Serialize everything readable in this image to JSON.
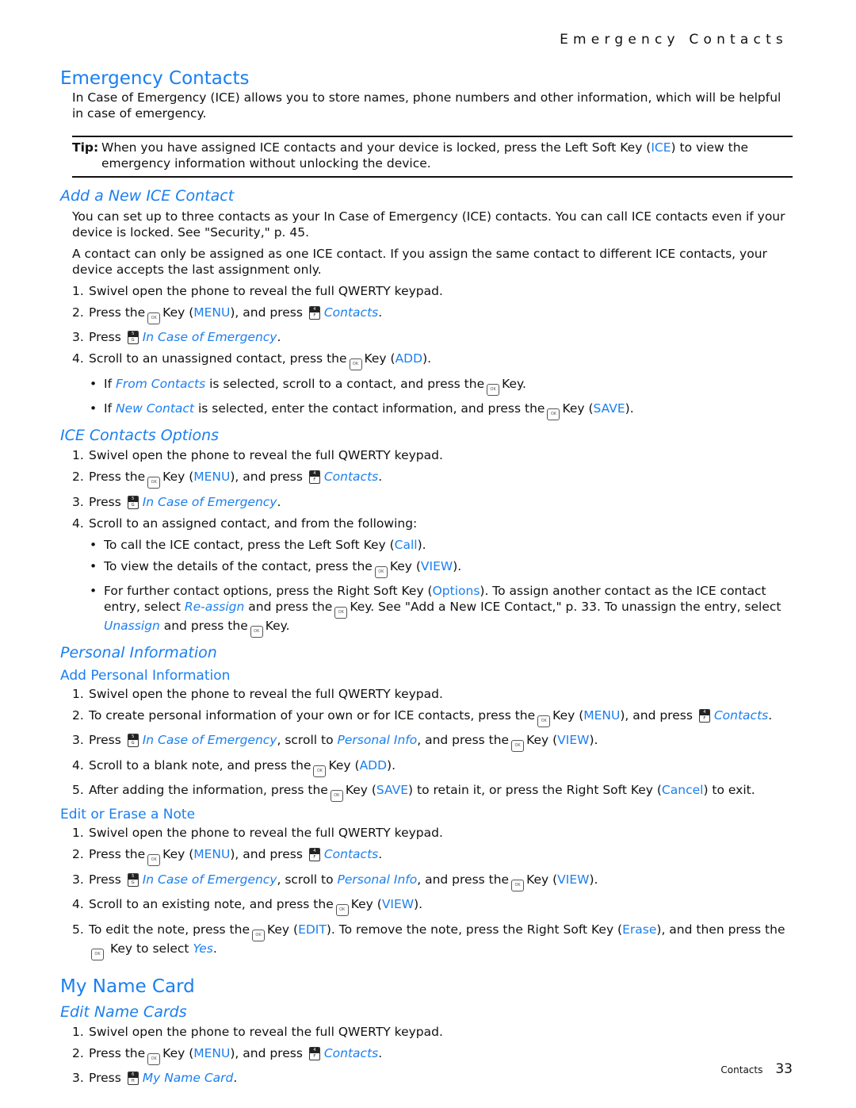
{
  "running_head": "Emergency Contacts",
  "accent_color": "#1a7ff0",
  "icons": {
    "ok_key": "ok-key-icon",
    "key_4f": {
      "top": "4",
      "bottom": "F"
    },
    "key_5g": {
      "top": "5",
      "bottom": "G"
    },
    "key_6h": {
      "top": "6",
      "bottom": "H"
    }
  },
  "sections": {
    "emergency": {
      "title": "Emergency Contacts",
      "intro": "In Case of Emergency (ICE) allows you to store names, phone numbers and other information, which will be helpful in case of emergency.",
      "tip_label": "Tip:",
      "tip_pre": "When you have assigned ICE contacts and your device is locked, press the Left Soft Key (",
      "tip_ice": "ICE",
      "tip_post": ") to view the emergency information without unlocking the device."
    },
    "add_ice": {
      "title": "Add a New ICE Contact",
      "para1": "You can set up to three contacts as your In Case of Emergency (ICE) contacts. You can call ICE contacts even if your device is locked. See \"Security,\" p. 45.",
      "para2": "A contact can only be assigned as one ICE contact. If you assign the same contact to different ICE contacts, your device accepts the last assignment only."
    },
    "ice_options": {
      "title": "ICE Contacts Options"
    },
    "personal": {
      "title": "Personal Information",
      "add_title": "Add Personal Information",
      "edit_title": "Edit or Erase a Note"
    },
    "name_card": {
      "title": "My Name Card",
      "edit_title": "Edit Name Cards"
    }
  },
  "text": {
    "n1": "1.",
    "n2": "2.",
    "n3": "3.",
    "n4": "4.",
    "n5": "5.",
    "dot": "•",
    "swivel": "Swivel open the phone to reveal the full QWERTY keypad.",
    "press_the": "Press the",
    "press": "Press",
    "key_open": "Key (",
    "key": "Key",
    "close_dot": ").",
    "and_press": "), and press",
    "period": ".",
    "menu": "MENU",
    "contacts": "Contacts",
    "ice": "In Case of Emergency",
    "add": "ADD",
    "save": "SAVE",
    "view": "VIEW",
    "edit": "EDIT",
    "erase": "Erase",
    "cancel": "Cancel",
    "call": "Call",
    "options": "Options",
    "personal_info": "Personal Info",
    "my_name_card": "My Name Card",
    "from_contacts": "From Contacts",
    "new_contact": "New Contact",
    "reassign": "Re-assign",
    "unassign": "Unassign",
    "yes": "Yes",
    "scroll_unassigned": "Scroll to an unassigned contact, press the",
    "if": "If",
    "from_rest": "is selected, scroll to a contact, and press the",
    "key_end": "Key.",
    "new_rest": "is selected, enter the contact information, and press the",
    "scroll_assigned": "Scroll to an assigned contact, and from the following:",
    "call_pre": "To call the ICE contact, press the Left Soft Key (",
    "view_pre": "To view the details of the contact, press the",
    "further_pre": "For further contact options, press the Right Soft Key (",
    "further_mid": "). To assign another contact as the ICE contact entry, select",
    "further_mid2": "and press the",
    "further_mid3": "Key. See \"Add a New ICE Contact,\" p. 33. To unassign the entry, select",
    "further_end": "and press the",
    "create_pre": "To create personal information of your own or for ICE contacts, press the",
    "scroll_to": ", scroll to",
    "and_press_the": ", and press the",
    "blank_note": "Scroll to a blank note, and press the",
    "after_adding": "After adding the information, press the",
    "retain": ") to retain it, or press the Right Soft Key (",
    "to_exit": ") to exit.",
    "existing_note": "Scroll to an existing note, and press the",
    "edit_pre": "To edit the note, press the",
    "edit_mid": "). To remove the note, press the Right Soft Key (",
    "edit_mid2": "), and then press the",
    "key_to_select": "Key to select"
  },
  "footer": {
    "section": "Contacts",
    "page": "33"
  }
}
